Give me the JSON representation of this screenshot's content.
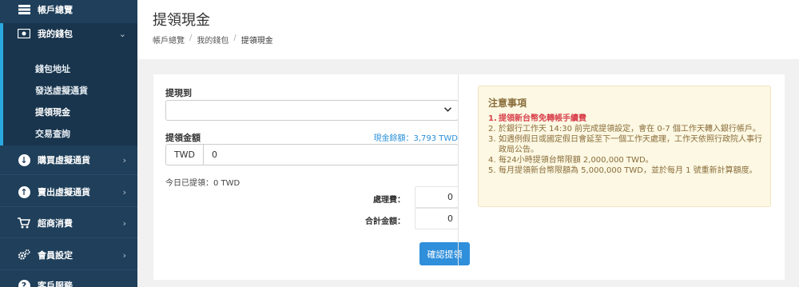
{
  "sidebar": {
    "items": [
      {
        "label": "帳戶總覽",
        "icon": "list-icon"
      },
      {
        "label": "我的錢包",
        "icon": "wallet-icon"
      },
      {
        "label": "購買虛擬通貨",
        "icon": "arrow-down-circle-icon"
      },
      {
        "label": "賣出虛擬通貨",
        "icon": "arrow-up-circle-icon"
      },
      {
        "label": "超商消費",
        "icon": "cart-icon"
      },
      {
        "label": "會員設定",
        "icon": "gears-icon"
      },
      {
        "label": "客戶服務",
        "icon": "support-icon"
      }
    ],
    "wallet_submenu": [
      {
        "label": "錢包地址"
      },
      {
        "label": "發送虛擬通貨"
      },
      {
        "label": "提領現金"
      },
      {
        "label": "交易查詢"
      }
    ]
  },
  "header": {
    "title": "提領現金",
    "breadcrumb": [
      "帳戶總覽",
      "我的錢包",
      "提領現金"
    ]
  },
  "form": {
    "withdraw_to_label": "提現到",
    "withdraw_to_value": "",
    "amount_label": "提領金額",
    "balance_text": "現金餘額：3,793 TWD",
    "currency": "TWD",
    "amount_value": "0",
    "today_withdrawn": "今日已提領：0 TWD",
    "fee_label": "處理費：",
    "fee_value": "0",
    "total_label": "合計金額：",
    "total_value": "0",
    "confirm_label": "確認提領"
  },
  "notice": {
    "title": "注意事項",
    "items": [
      "提領新台幣免轉帳手續費",
      "於銀行工作天 14:30 前完成提領設定，會在 0-7 個工作天轉入銀行帳戶。",
      "如遇例假日或國定假日會延至下一個工作天處理，工作天依照行政院人事行政局公告。",
      "每24小時提領台幣限額 2,000,000 TWD。",
      "每月提領新台幣限額為 5,000,000 TWD，並於每月 1 號重新計算額度。"
    ]
  },
  "colors": {
    "sidebar_bg": "#1f3f5a",
    "accent_blue": "#2f8fdb",
    "notice_bg": "#fcf8e3",
    "notice_text": "#8a6d3b",
    "notice_red": "#d9434e"
  }
}
